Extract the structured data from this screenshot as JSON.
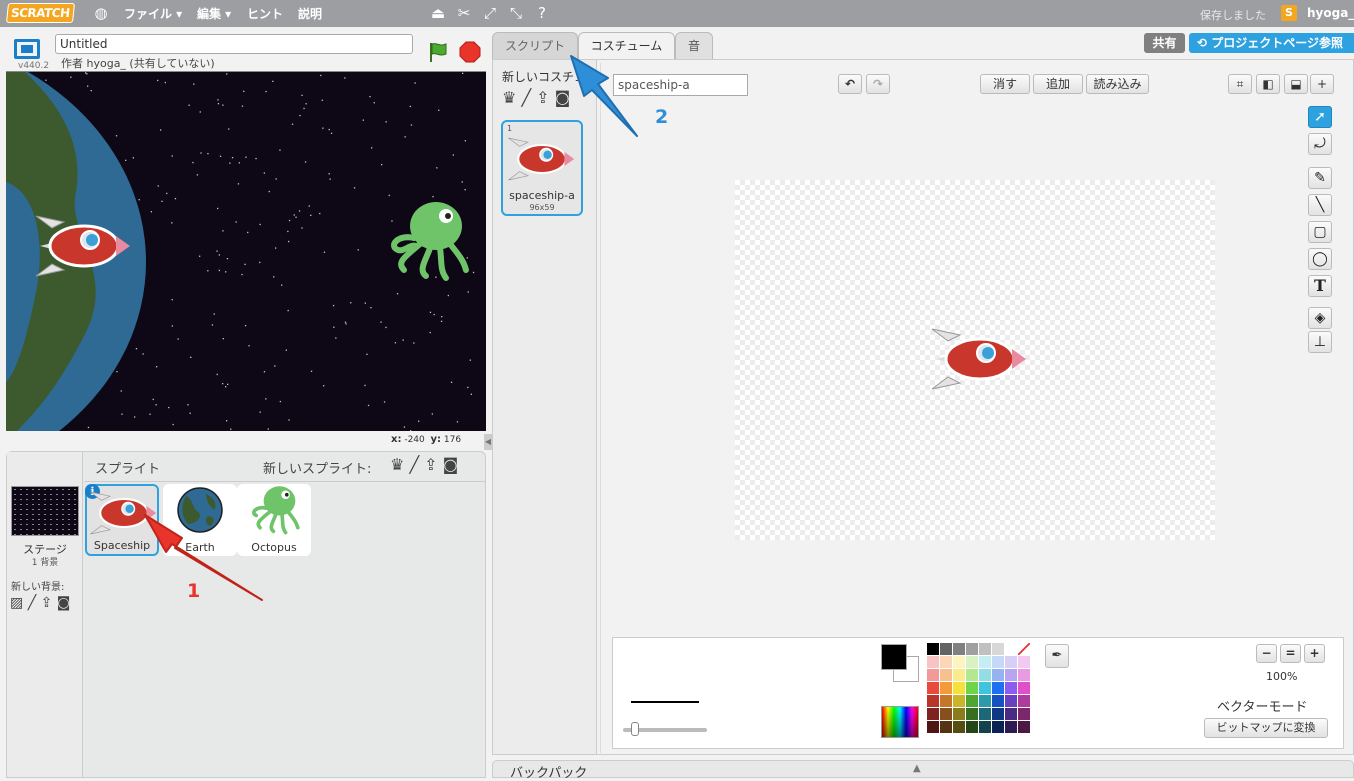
{
  "menubar": {
    "logo": "SCRATCH",
    "globe_icon": "globe-icon",
    "file": "ファイル ▾",
    "edit": "編集 ▾",
    "tips": "ヒント",
    "about": "説明",
    "saved_status": "保存しました",
    "username": "hyoga_",
    "user_avatar_letter": "S"
  },
  "stage_header": {
    "version": "v440.2",
    "project_title": "Untitled",
    "owner": "作者 hyoga_ (共有していない)"
  },
  "coords": {
    "x_label": "x:",
    "x": "-240",
    "y_label": "y:",
    "y": "176"
  },
  "sprite_pane": {
    "stage_label": "ステージ",
    "backdrop_count": "1 背景",
    "new_backdrop": "新しい背景:",
    "sprites_title": "スプライト",
    "new_sprite": "新しいスプライト:",
    "sprites": [
      {
        "name": "Spaceship",
        "selected": true
      },
      {
        "name": "Earth",
        "selected": false
      },
      {
        "name": "Octopus",
        "selected": false
      }
    ],
    "info_badge": "i"
  },
  "tabs": [
    {
      "label": "スクリプト"
    },
    {
      "label": "コスチューム",
      "active": true
    },
    {
      "label": "音"
    }
  ],
  "top_right": {
    "share": "共有",
    "project_page": "プロジェクトページ参照"
  },
  "costumes": {
    "new_costume": "新しいコスチューム:",
    "items": [
      {
        "number": "1",
        "name": "spaceship-a",
        "size": "96x59"
      }
    ]
  },
  "paint_editor": {
    "costume_name": "spaceship-a",
    "clear": "消す",
    "add": "追加",
    "import": "読み込み",
    "zoom_level": "100%",
    "mode": "ベクターモード",
    "convert": "ビットマップに変換",
    "text_tool": "T"
  },
  "backpack": {
    "label": "バックパック"
  },
  "annotations": [
    {
      "number": "1",
      "color": "#e8342a"
    },
    {
      "number": "2",
      "color": "#2e8fd8"
    }
  ],
  "colors": {
    "accent_blue": "#2ea1e0",
    "menubar": "#9c9ea2",
    "arrow_red": "#e8342a",
    "arrow_blue": "#2e8fd8"
  },
  "palette": [
    "#000000",
    "#636363",
    "#808080",
    "#a0a0a0",
    "#c0c0c0",
    "#d8d8d8",
    "#ffffff",
    "none",
    "#f8c3c3",
    "#fbd7b7",
    "#fdf5c0",
    "#d8f3c1",
    "#c4eef2",
    "#c4d8f7",
    "#d8cff7",
    "#f3c9ef",
    "#f29a9a",
    "#f7c08f",
    "#fbec8b",
    "#b2e88f",
    "#93dde7",
    "#93b4f0",
    "#b8a4f0",
    "#e89be0",
    "#e84a3c",
    "#f59a3a",
    "#f6e03a",
    "#6fd44a",
    "#3ec5dd",
    "#1e70f0",
    "#8c5cf0",
    "#e04ec9",
    "#b8352a",
    "#c4762a",
    "#c9b42a",
    "#4ea632",
    "#2c9aad",
    "#1552c0",
    "#6a3fc0",
    "#b13a9e",
    "#7e2320",
    "#86501d",
    "#8a7b1d",
    "#366f22",
    "#1d6876",
    "#0e3884",
    "#4a2b84",
    "#7a276c",
    "#4f1513",
    "#553212",
    "#574d12",
    "#224616",
    "#12424b",
    "#092354",
    "#2f1b54",
    "#4d1844"
  ]
}
